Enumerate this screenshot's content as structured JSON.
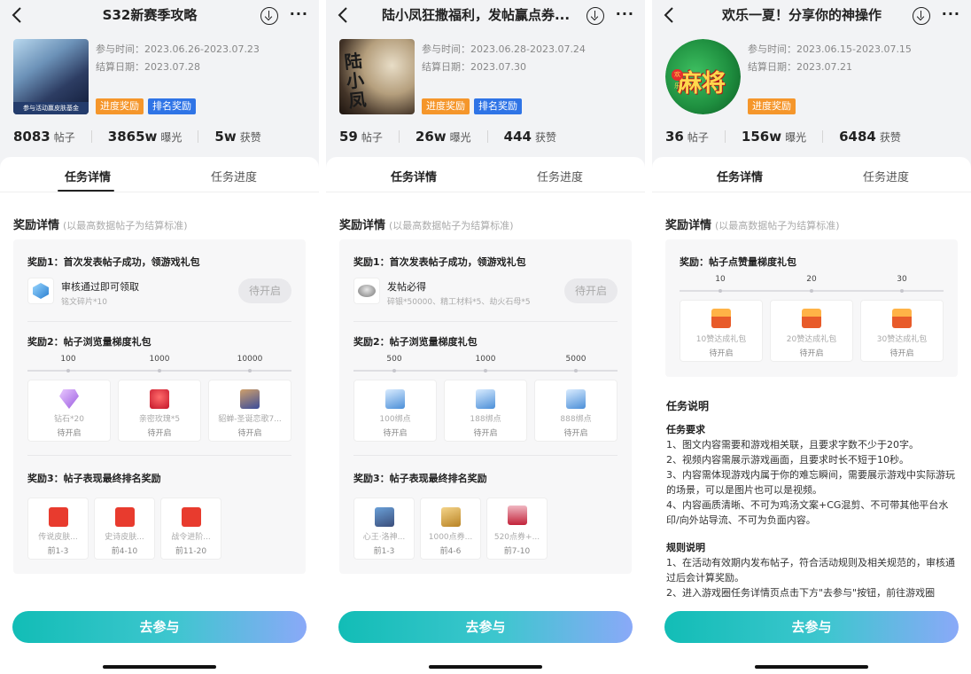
{
  "screens": [
    {
      "title": "S32新赛季攻略",
      "cover_caption": "参与活动赢皮肤基金",
      "participate_time": "参与时间：2023.06.26-2023.07.23",
      "settle_date": "结算日期：2023.07.28",
      "badges": [
        "进度奖励",
        "排名奖励"
      ],
      "stats": [
        {
          "value": "8083",
          "unit": "帖子"
        },
        {
          "value": "3865w",
          "unit": "曝光"
        },
        {
          "value": "5w",
          "unit": "获赞"
        }
      ],
      "tabs": [
        "任务详情",
        "任务进度"
      ],
      "section_title": "奖励详情",
      "section_note": "(以最高数据帖子为结算标准)",
      "r1": {
        "title": "奖励1：首次发表帖子成功，领游戏礼包",
        "name": "审核通过即可领取",
        "sub": "铭文碎片*10",
        "btn": "待开启",
        "icon": "crystal-icon"
      },
      "r2": {
        "title": "奖励2：帖子浏览量梯度礼包",
        "ticks": [
          "100",
          "1000",
          "10000"
        ],
        "cards": [
          {
            "name": "钻石*20",
            "status": "待开启",
            "icon": "gem-icon"
          },
          {
            "name": "亲密玫瑰*5",
            "status": "待开启",
            "icon": "rose-icon"
          },
          {
            "name": "貂蝉-圣诞恋歌7...",
            "status": "待开启",
            "icon": "avatar-icon"
          }
        ]
      },
      "r3": {
        "title": "奖励3：帖子表现最终排名奖励",
        "cards": [
          {
            "name": "传说皮肤...",
            "rank": "前1-3",
            "icon": "red-envelope-icon"
          },
          {
            "name": "史诗皮肤...",
            "rank": "前4-10",
            "icon": "red-envelope-icon"
          },
          {
            "name": "战令进阶...",
            "rank": "前11-20",
            "icon": "red-envelope-icon"
          }
        ]
      },
      "cta": "去参与"
    },
    {
      "title": "陆小凤狂撒福利，发帖赢点券...",
      "cover_text": "陆小凤",
      "participate_time": "参与时间：2023.06.28-2023.07.24",
      "settle_date": "结算日期：2023.07.30",
      "badges": [
        "进度奖励",
        "排名奖励"
      ],
      "stats": [
        {
          "value": "59",
          "unit": "帖子"
        },
        {
          "value": "26w",
          "unit": "曝光"
        },
        {
          "value": "444",
          "unit": "获赞"
        }
      ],
      "tabs": [
        "任务详情",
        "任务进度"
      ],
      "section_title": "奖励详情",
      "section_note": "(以最高数据帖子为结算标准)",
      "r1": {
        "title": "奖励1：首次发表帖子成功，领游戏礼包",
        "name": "发帖必得",
        "sub": "碎银*50000、精工材料*5、劫火石母*5",
        "btn": "待开启",
        "icon": "coins-icon"
      },
      "r2": {
        "title": "奖励2：帖子浏览量梯度礼包",
        "ticks": [
          "500",
          "1000",
          "5000"
        ],
        "cards": [
          {
            "name": "100绑点",
            "status": "待开启",
            "icon": "ticket-icon"
          },
          {
            "name": "188绑点",
            "status": "待开启",
            "icon": "ticket-icon"
          },
          {
            "name": "888绑点",
            "status": "待开启",
            "icon": "ticket-icon"
          }
        ]
      },
      "r3": {
        "title": "奖励3：帖子表现最终排名奖励",
        "cards": [
          {
            "name": "心王·洛神...",
            "rank": "前1-3",
            "icon": "hero-icon"
          },
          {
            "name": "1000点券...",
            "rank": "前4-6",
            "icon": "scroll-icon"
          },
          {
            "name": "520点券+...",
            "rank": "前7-10",
            "icon": "sword-icon"
          }
        ]
      },
      "cta": "去参与"
    },
    {
      "title": "欢乐一夏！分享你的神操作",
      "cover_text": "麻将",
      "cover_tag": "欢乐",
      "participate_time": "参与时间：2023.06.15-2023.07.15",
      "settle_date": "结算日期：2023.07.21",
      "badges": [
        "进度奖励"
      ],
      "stats": [
        {
          "value": "36",
          "unit": "帖子"
        },
        {
          "value": "156w",
          "unit": "曝光"
        },
        {
          "value": "6484",
          "unit": "获赞"
        }
      ],
      "tabs": [
        "任务详情",
        "任务进度"
      ],
      "section_title": "奖励详情",
      "section_note": "(以最高数据帖子为结算标准)",
      "r2": {
        "title": "奖励：帖子点赞量梯度礼包",
        "ticks": [
          "10",
          "20",
          "30"
        ],
        "cards": [
          {
            "name": "10赞达成礼包",
            "status": "待开启",
            "icon": "gift-icon"
          },
          {
            "name": "20赞达成礼包",
            "status": "待开启",
            "icon": "gift-icon"
          },
          {
            "name": "30赞达成礼包",
            "status": "待开启",
            "icon": "gift-icon"
          }
        ]
      },
      "info": {
        "title": "任务说明",
        "req_title": "任务要求",
        "req": "1、图文内容需要和游戏相关联，且要求字数不少于20字。\n2、视频内容需展示游戏画面，且要求时长不短于10秒。\n3、内容需体现游戏内属于你的难忘瞬间，需要展示游戏中实际游玩的场景，可以是图片也可以是视频。\n4、内容画质清晰、不可为鸡汤文案+CG混剪、不可带其他平台水印/向外站导流、不可为负面内容。",
        "rule_title": "规则说明",
        "rule": "1、在活动有效期内发布帖子，符合活动规则及相关规范的，审核通过后会计算奖励。\n2、进入游戏圈任务详情页点击下方\"去参与\"按钮，前往游戏圈"
      },
      "cta": "去参与"
    }
  ]
}
